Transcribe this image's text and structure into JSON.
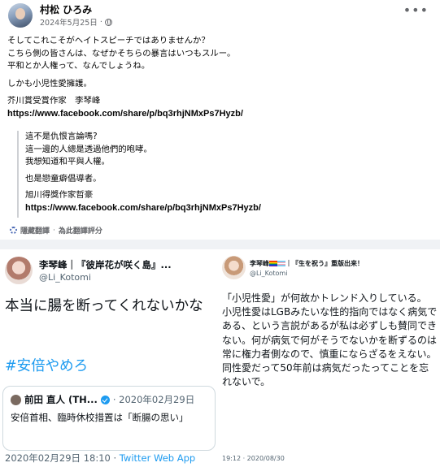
{
  "facebook_post": {
    "author": "村松 ひろみ",
    "date": "2024年5月25日",
    "separator": "·",
    "body_lines": [
      "そしてこれこそがヘイトスピーチではありませんか？",
      "こちら側の皆さんは、なぜかそちらの暴言はいつもスルー。",
      "平和とか人権って、なんでしょうね。",
      "しかも小児性愛擁護。",
      "芥川賞受賞作家　李琴峰",
      "https://www.facebook.com/share/p/bq3rhjNMxPs7Hyzb/"
    ],
    "translation_lines": [
      "這不是仇恨言論嗎?",
      "這一邊的人總是透過他們的咆哮。",
      "我想知道和平與人權。",
      "也是戀童癖倡導者。",
      "旭川得獎作家哲豪",
      "https://www.facebook.com/share/p/bq3rhjNMxPs7Hyzb/"
    ],
    "hide_translation_label": "隱藏翻譯",
    "rate_translation_label": "為此翻譯評分",
    "dot": "·"
  },
  "tweet_left": {
    "name": "李琴峰｜『彼岸花が咲く島』...",
    "handle": "@Li_Kotomi",
    "text": "本当に腸を断ってくれないかな",
    "hashtag": "#安倍やめろ",
    "quote": {
      "name": "前田 直人 (TH...",
      "date": "· 2020年02月29日",
      "text": "安倍首相、臨時休校措置は「断腸の思い」"
    },
    "timestamp": "2020年02月29日 18:10 · ",
    "app": "Twitter Web App"
  },
  "tweet_right": {
    "name_prefix": "李琴峰",
    "name_suffix": "｜『生を祝う』重版出来！",
    "handle": "@Li_Kotomi",
    "text_lines": [
      "「小児性愛」が何故かトレンド入りしている。",
      "小児性愛はLGBみたいな性的指向ではなく病気である、という言説があるが私は必ずしも賛同できない。何が病気で何がそうでないかを断ずるのは常に権力者側なので、慎重にならざるをえない。",
      "同性愛だって50年前は病気だったってことを忘れないで。"
    ],
    "timestamp": "19:12 · 2020/08/30"
  },
  "colors": {
    "link_blue": "#1d9bf0",
    "fb_secondary": "#65676b",
    "divider": "#f0f2f5"
  },
  "icons": [
    "globe-icon",
    "more-icon",
    "gear-icon",
    "verified-icon",
    "rainbow-flag-icon",
    "trans-flag-icon"
  ]
}
